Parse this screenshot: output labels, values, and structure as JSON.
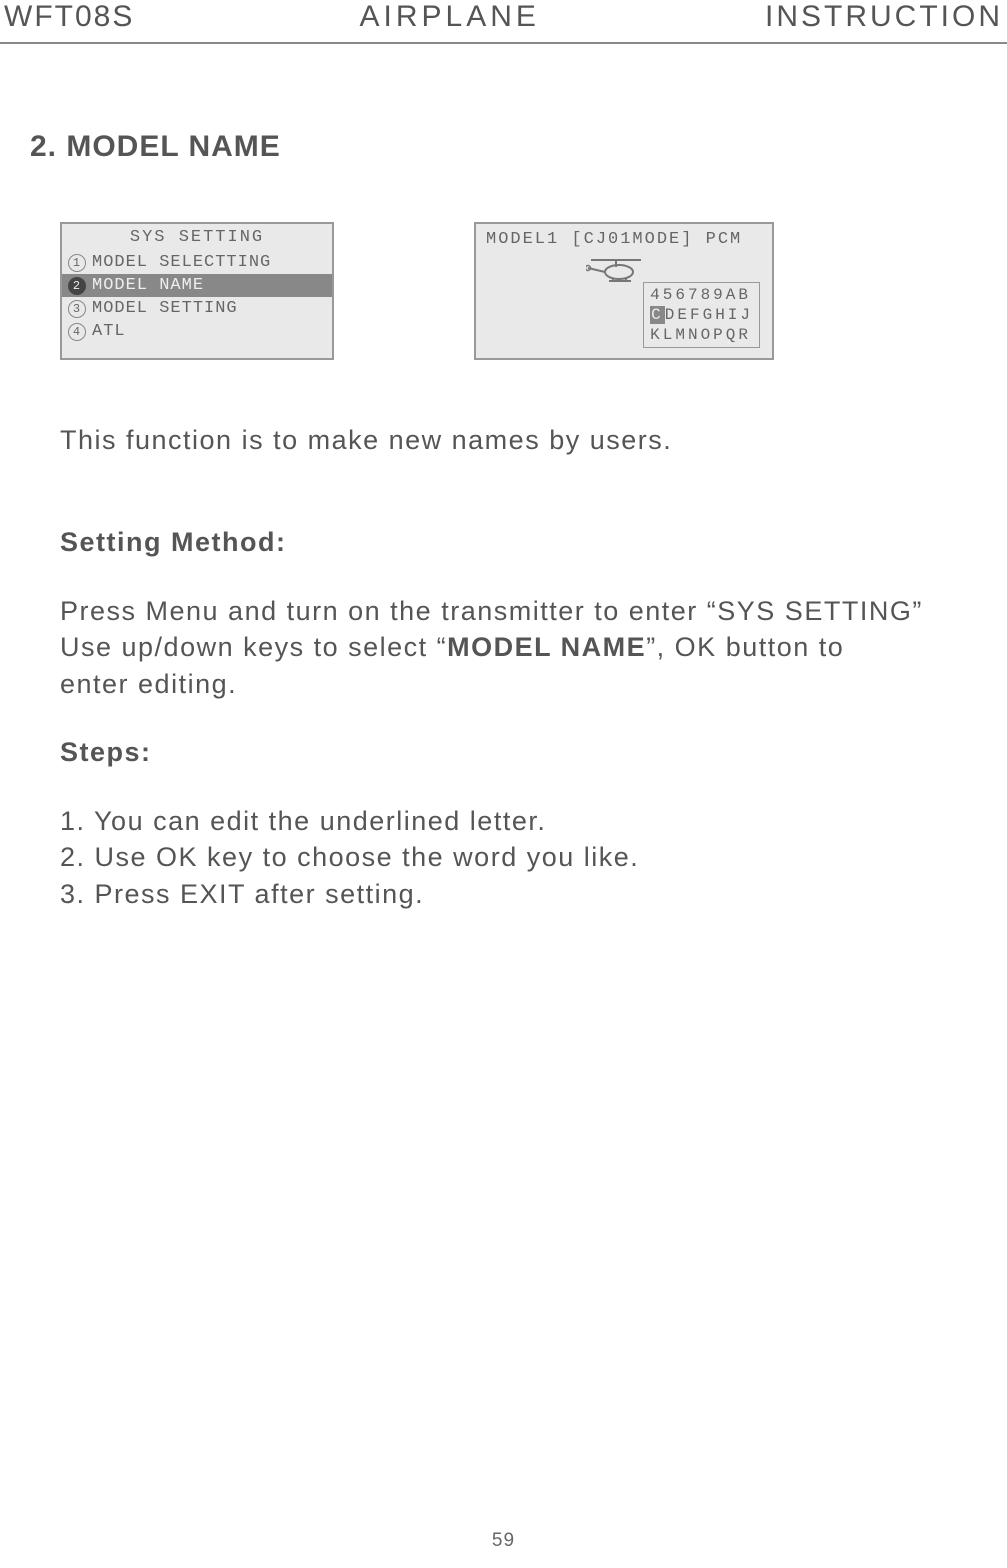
{
  "header": {
    "left": "WFT08S",
    "center": "AIRPLANE",
    "right": "INSTRUCTION"
  },
  "section": {
    "title": "2. MODEL NAME"
  },
  "screen1": {
    "title": "SYS SETTING",
    "items": [
      {
        "num": "1",
        "label": "MODEL SELECTTING",
        "selected": false
      },
      {
        "num": "2",
        "label": "MODEL NAME",
        "selected": true
      },
      {
        "num": "3",
        "label": "MODEL SETTING",
        "selected": false
      },
      {
        "num": "4",
        "label": "ATL",
        "selected": false
      }
    ]
  },
  "screen2": {
    "top": "MODEL1 [CJ01MODE] PCM",
    "grid_rows": [
      "456789AB",
      "CDEFGHIJ",
      "KLMNOPQR"
    ],
    "highlight_char": "C"
  },
  "body": {
    "intro": "This function is to make new names by users.",
    "setting_heading": "Setting Method:",
    "method_line1": "Press Menu and turn on the transmitter to enter “SYS SETTING”",
    "method_line2a": "Use up/down keys to select “",
    "method_bold": "MODEL NAME",
    "method_line2b": "”, OK button to",
    "method_line3": "enter editing.",
    "steps_heading": "Steps:",
    "step1": "1. You can edit the underlined letter.",
    "step2": "2. Use OK key to choose the word you like.",
    "step3": "3. Press EXIT after setting."
  },
  "page_number": "59"
}
